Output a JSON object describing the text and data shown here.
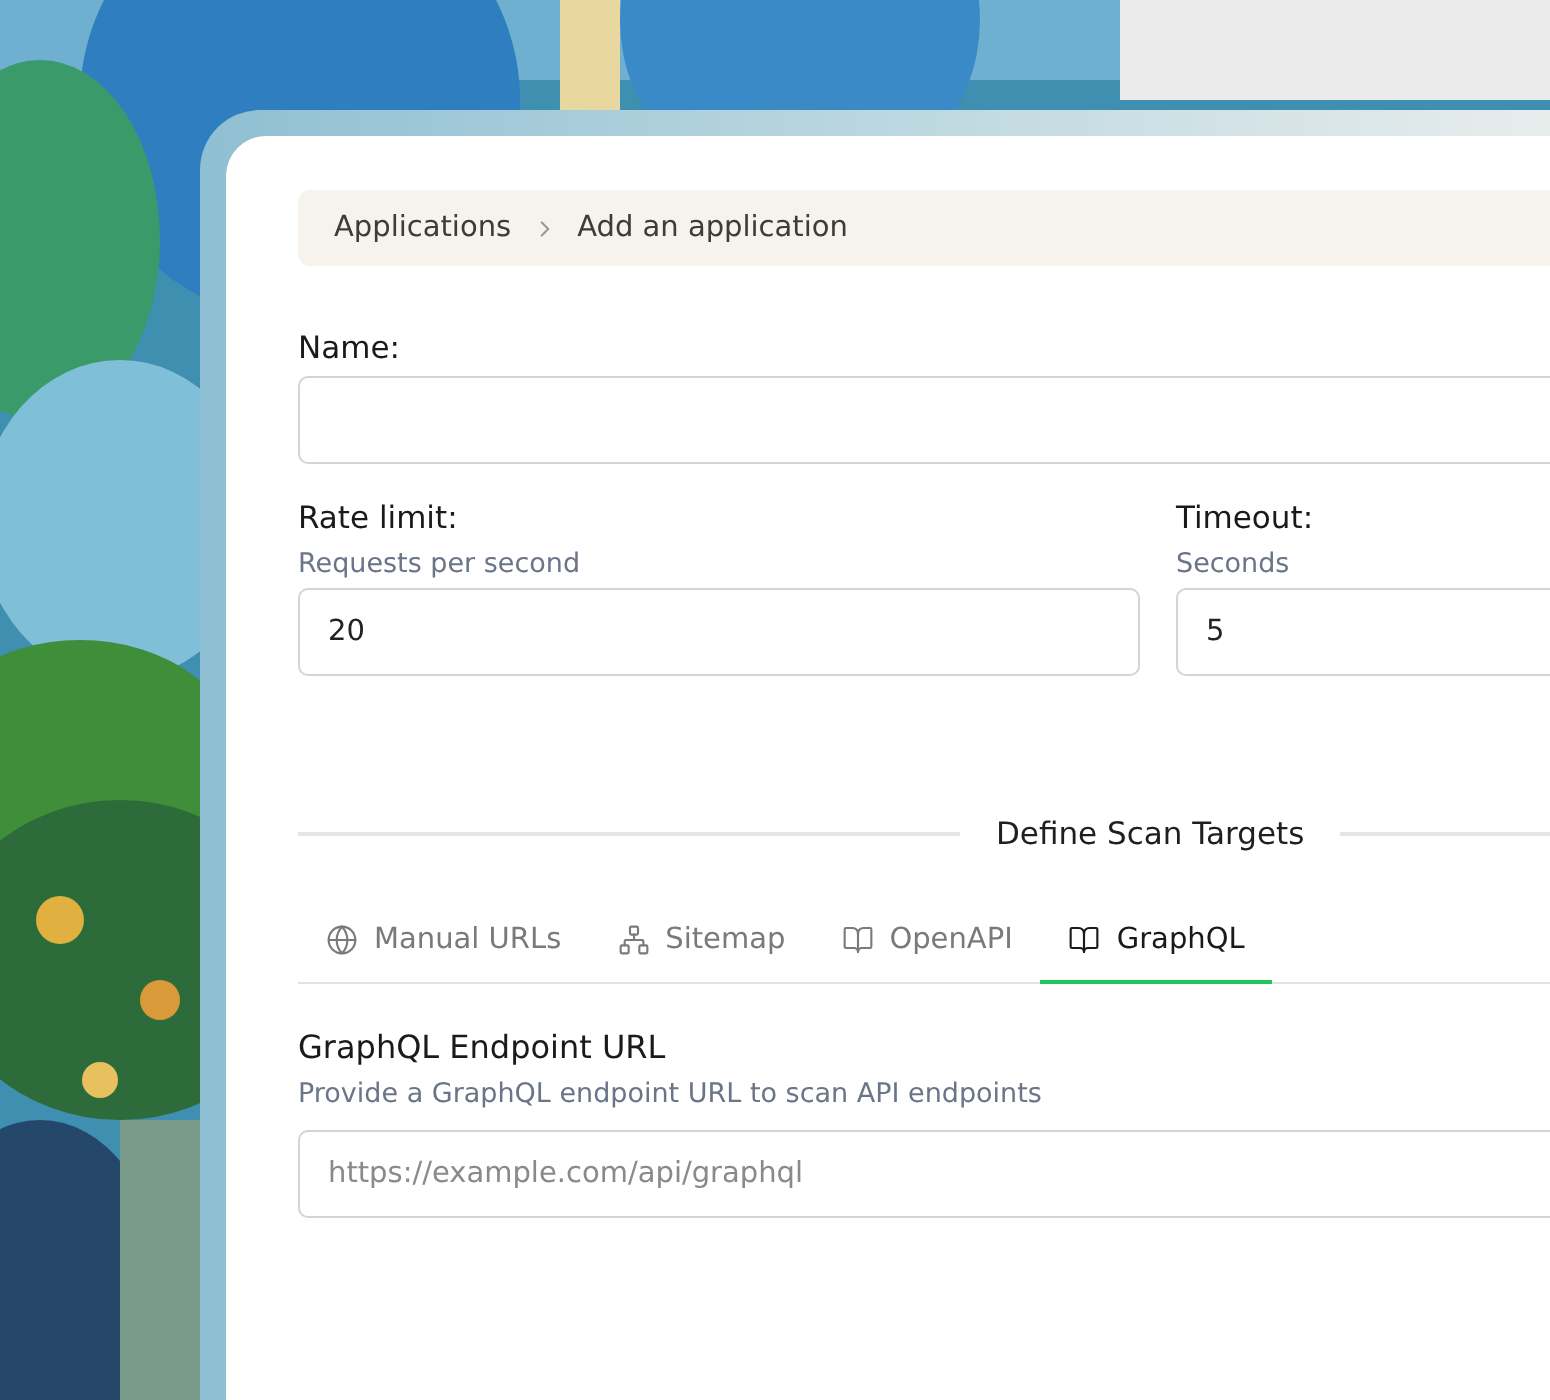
{
  "breadcrumb": [
    "Applications",
    "Add an application"
  ],
  "name_field": {
    "label": "Name:"
  },
  "rate_limit": {
    "label": "Rate limit:",
    "hint": "Requests per second",
    "value": "20"
  },
  "timeout": {
    "label": "Timeout:",
    "hint": "Seconds",
    "value": "5"
  },
  "section_title": "Define Scan Targets",
  "tabs": [
    {
      "label": "Manual URLs",
      "kind": "urls",
      "selected": false
    },
    {
      "label": "Sitemap",
      "kind": "sitemap",
      "selected": false
    },
    {
      "label": "OpenAPI",
      "kind": "spec",
      "selected": false
    },
    {
      "label": "GraphQL",
      "kind": "spec",
      "selected": true
    }
  ],
  "endpoint": {
    "title": "GraphQL Endpoint URL",
    "description": "Provide a GraphQL endpoint URL to scan API endpoints",
    "placeholder": "https://example.com/api/graphql"
  }
}
